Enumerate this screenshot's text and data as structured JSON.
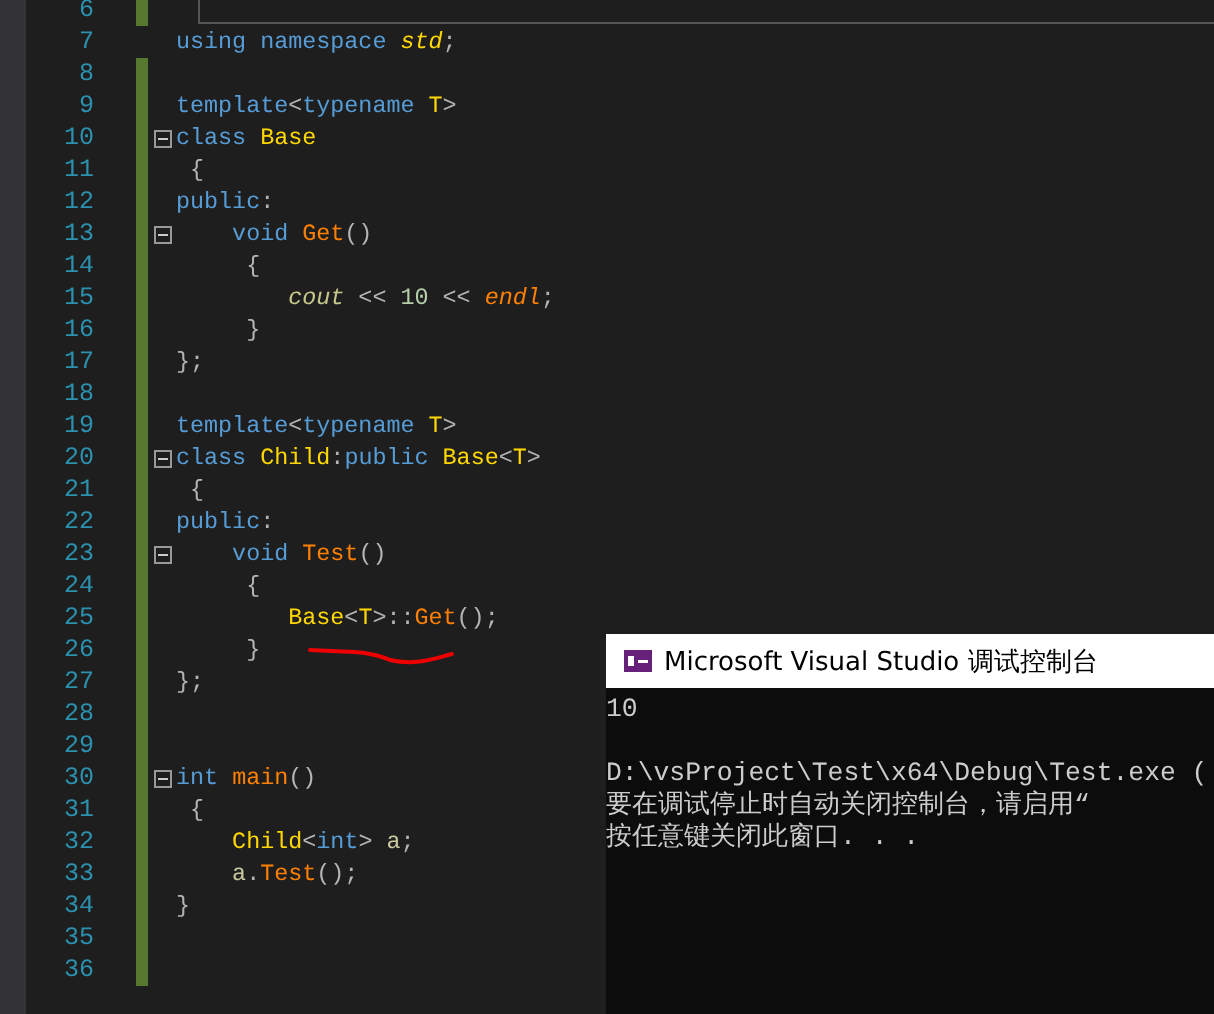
{
  "editor": {
    "lines": [
      {
        "number": "6",
        "changed": true,
        "foldable": false
      },
      {
        "number": "7",
        "changed": false,
        "foldable": false,
        "tokens": [
          {
            "text": "using namespace ",
            "kind": "keyword"
          },
          {
            "text": "std",
            "kind": "namespace"
          },
          {
            "text": ";",
            "kind": "plain"
          }
        ]
      },
      {
        "number": "8",
        "changed": true,
        "foldable": false
      },
      {
        "number": "9",
        "changed": true,
        "foldable": false,
        "tokens": [
          {
            "text": "template",
            "kind": "keyword"
          },
          {
            "text": "<",
            "kind": "plain"
          },
          {
            "text": "typename ",
            "kind": "keyword"
          },
          {
            "text": "T",
            "kind": "type"
          },
          {
            "text": ">",
            "kind": "plain"
          }
        ]
      },
      {
        "number": "10",
        "changed": true,
        "foldable": true,
        "tokens": [
          {
            "text": "class ",
            "kind": "keyword"
          },
          {
            "text": "Base",
            "kind": "type"
          }
        ]
      },
      {
        "number": "11",
        "changed": true,
        "foldable": false,
        "tokens": [
          {
            "text": " {",
            "kind": "plain"
          }
        ]
      },
      {
        "number": "12",
        "changed": true,
        "foldable": false,
        "tokens": [
          {
            "text": "public",
            "kind": "keyword"
          },
          {
            "text": ":",
            "kind": "plain"
          }
        ]
      },
      {
        "number": "13",
        "changed": true,
        "foldable": true,
        "tokens": [
          {
            "text": "    void ",
            "kind": "keyword"
          },
          {
            "text": "Get",
            "kind": "function"
          },
          {
            "text": "()",
            "kind": "plain"
          }
        ]
      },
      {
        "number": "14",
        "changed": true,
        "foldable": false,
        "tokens": [
          {
            "text": "     {",
            "kind": "plain"
          }
        ]
      },
      {
        "number": "15",
        "changed": true,
        "foldable": false,
        "tokens": [
          {
            "text": "        cout",
            "kind": "global"
          },
          {
            "text": " << ",
            "kind": "plain"
          },
          {
            "text": "10",
            "kind": "number"
          },
          {
            "text": " << ",
            "kind": "plain"
          },
          {
            "text": "endl",
            "kind": "macro"
          },
          {
            "text": ";",
            "kind": "plain"
          }
        ]
      },
      {
        "number": "16",
        "changed": true,
        "foldable": false,
        "tokens": [
          {
            "text": "     }",
            "kind": "plain"
          }
        ]
      },
      {
        "number": "17",
        "changed": true,
        "foldable": false,
        "tokens": [
          {
            "text": "};",
            "kind": "plain"
          }
        ]
      },
      {
        "number": "18",
        "changed": true,
        "foldable": false
      },
      {
        "number": "19",
        "changed": true,
        "foldable": false,
        "tokens": [
          {
            "text": "template",
            "kind": "keyword"
          },
          {
            "text": "<",
            "kind": "plain"
          },
          {
            "text": "typename ",
            "kind": "keyword"
          },
          {
            "text": "T",
            "kind": "type"
          },
          {
            "text": ">",
            "kind": "plain"
          }
        ]
      },
      {
        "number": "20",
        "changed": true,
        "foldable": true,
        "tokens": [
          {
            "text": "class ",
            "kind": "keyword"
          },
          {
            "text": "Child",
            "kind": "type"
          },
          {
            "text": ":",
            "kind": "plain"
          },
          {
            "text": "public ",
            "kind": "keyword"
          },
          {
            "text": "Base",
            "kind": "type"
          },
          {
            "text": "<",
            "kind": "plain"
          },
          {
            "text": "T",
            "kind": "type"
          },
          {
            "text": ">",
            "kind": "plain"
          }
        ]
      },
      {
        "number": "21",
        "changed": true,
        "foldable": false,
        "tokens": [
          {
            "text": " {",
            "kind": "plain"
          }
        ]
      },
      {
        "number": "22",
        "changed": true,
        "foldable": false,
        "tokens": [
          {
            "text": "public",
            "kind": "keyword"
          },
          {
            "text": ":",
            "kind": "plain"
          }
        ]
      },
      {
        "number": "23",
        "changed": true,
        "foldable": true,
        "tokens": [
          {
            "text": "    void ",
            "kind": "keyword"
          },
          {
            "text": "Test",
            "kind": "function"
          },
          {
            "text": "()",
            "kind": "plain"
          }
        ]
      },
      {
        "number": "24",
        "changed": true,
        "foldable": false,
        "tokens": [
          {
            "text": "     {",
            "kind": "plain"
          }
        ]
      },
      {
        "number": "25",
        "changed": true,
        "foldable": false,
        "tokens": [
          {
            "text": "        Base",
            "kind": "type"
          },
          {
            "text": "<",
            "kind": "plain"
          },
          {
            "text": "T",
            "kind": "type"
          },
          {
            "text": ">::",
            "kind": "plain"
          },
          {
            "text": "Get",
            "kind": "function"
          },
          {
            "text": "();",
            "kind": "plain"
          }
        ]
      },
      {
        "number": "26",
        "changed": true,
        "foldable": false,
        "tokens": [
          {
            "text": "     }",
            "kind": "plain"
          }
        ]
      },
      {
        "number": "27",
        "changed": true,
        "foldable": false,
        "tokens": [
          {
            "text": "};",
            "kind": "plain"
          }
        ]
      },
      {
        "number": "28",
        "changed": true,
        "foldable": false
      },
      {
        "number": "29",
        "changed": true,
        "foldable": false
      },
      {
        "number": "30",
        "changed": true,
        "foldable": true,
        "tokens": [
          {
            "text": "int ",
            "kind": "keyword"
          },
          {
            "text": "main",
            "kind": "function"
          },
          {
            "text": "()",
            "kind": "plain"
          }
        ]
      },
      {
        "number": "31",
        "changed": true,
        "foldable": false,
        "tokens": [
          {
            "text": " {",
            "kind": "plain"
          }
        ]
      },
      {
        "number": "32",
        "changed": true,
        "foldable": false,
        "tokens": [
          {
            "text": "    Child",
            "kind": "type"
          },
          {
            "text": "<",
            "kind": "plain"
          },
          {
            "text": "int",
            "kind": "keyword"
          },
          {
            "text": "> ",
            "kind": "plain"
          },
          {
            "text": "a",
            "kind": "variable"
          },
          {
            "text": ";",
            "kind": "plain"
          }
        ]
      },
      {
        "number": "33",
        "changed": true,
        "foldable": false,
        "tokens": [
          {
            "text": "    a",
            "kind": "variable"
          },
          {
            "text": ".",
            "kind": "plain"
          },
          {
            "text": "Test",
            "kind": "function"
          },
          {
            "text": "();",
            "kind": "plain"
          }
        ]
      },
      {
        "number": "34",
        "changed": true,
        "foldable": false,
        "tokens": [
          {
            "text": "}",
            "kind": "plain"
          }
        ]
      },
      {
        "number": "35",
        "changed": true,
        "foldable": false
      },
      {
        "number": "36",
        "changed": true,
        "foldable": false
      }
    ]
  },
  "console": {
    "title": "Microsoft Visual Studio 调试控制台",
    "output": [
      "10"
    ],
    "messages": [
      "D:\\vsProject\\Test\\x64\\Debug\\Test.exe (",
      "要在调试停止时自动关闭控制台，请启用“",
      "按任意键关闭此窗口. . ."
    ]
  }
}
